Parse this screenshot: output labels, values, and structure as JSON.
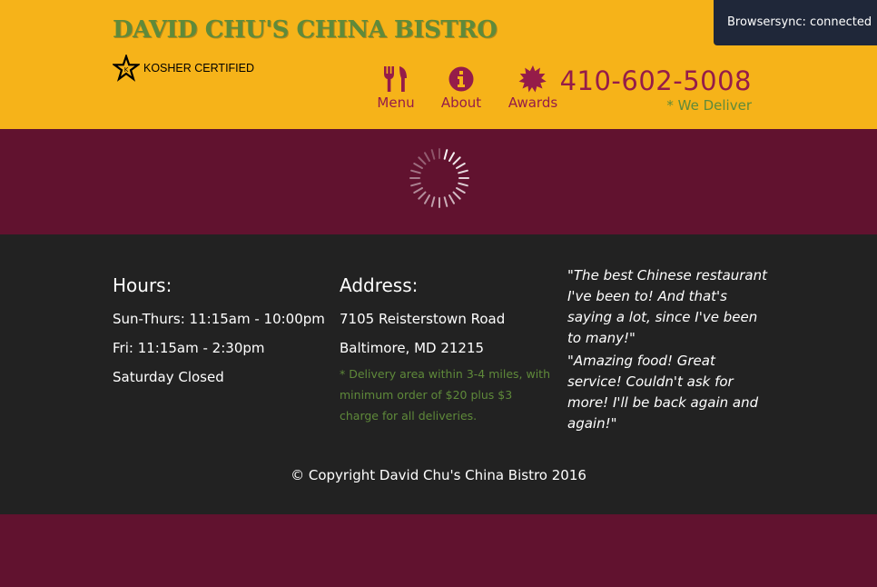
{
  "header": {
    "brand": "DAVID CHU'S CHINA BISTRO",
    "kosher_label": "KOSHER CERTIFIED",
    "nav": [
      {
        "label": "Menu",
        "icon": "fork-knife-icon"
      },
      {
        "label": "About",
        "icon": "info-icon"
      },
      {
        "label": "Awards",
        "icon": "certificate-icon"
      }
    ],
    "phone": "410-602-5008",
    "deliver": "* We Deliver"
  },
  "browsersync": {
    "text": "Browsersync: connected"
  },
  "main": {
    "loading_icon": "spinner-icon"
  },
  "footer": {
    "hours": {
      "title": "Hours:",
      "lines": [
        "Sun-Thurs: 11:15am - 10:00pm",
        "Fri: 11:15am - 2:30pm",
        "Saturday Closed"
      ]
    },
    "address": {
      "title": "Address:",
      "lines": [
        "7105 Reisterstown Road",
        "Baltimore, MD 21215"
      ],
      "note": "* Delivery area within 3-4 miles, with minimum order of $20 plus $3 charge for all deliveries."
    },
    "testimonials": [
      "\"The best Chinese restaurant I've been to! And that's saying a lot, since I've been to many!\"",
      "\"Amazing food! Great service! Couldn't ask for more! I'll be back again and again!\""
    ],
    "copyright": "© Copyright David Chu's China Bistro 2016"
  },
  "colors": {
    "header_bg": "#f6b319",
    "maroon": "#61122f",
    "accent": "#951c49",
    "green": "#5f8a3a",
    "footer_bg": "#222222"
  }
}
